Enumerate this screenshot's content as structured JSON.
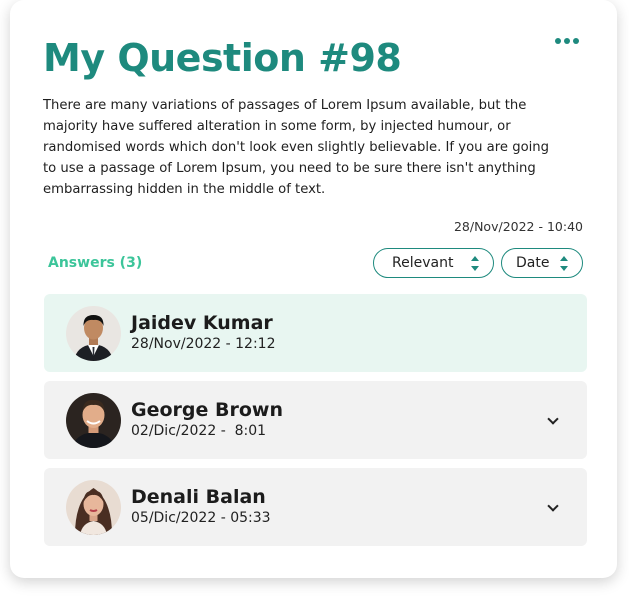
{
  "question": {
    "title": "My Question #98",
    "body": "There are many variations of passages of Lorem Ipsum available, but the majority have suffered alteration in some form, by injected humour, or randomised words which don't look even slightly believable. If you are going to use a passage of Lorem Ipsum, you need to be sure there isn't anything embarrassing hidden in the middle of text.",
    "date": "28/Nov/2022 - 10:40",
    "menu_icon": "more-horizontal-icon"
  },
  "answers_header": {
    "label": "Answers (3)",
    "sort_relevant": "Relevant",
    "sort_date": "Date",
    "sort_icon": "sort-up-down-icon"
  },
  "answers": [
    {
      "name": "Jaidev Kumar",
      "date": "28/Nov/2022 - 12:12",
      "expanded": true
    },
    {
      "name": "George Brown",
      "date": "02/Dic/2022 -  8:01",
      "expanded": false
    },
    {
      "name": "Denali Balan",
      "date": "05/Dic/2022 - 05:33",
      "expanded": false
    }
  ],
  "colors": {
    "accent": "#1e8a7e",
    "answers_label": "#3cc59a",
    "active_row": "#e8f6f1",
    "row": "#f2f2f2"
  }
}
